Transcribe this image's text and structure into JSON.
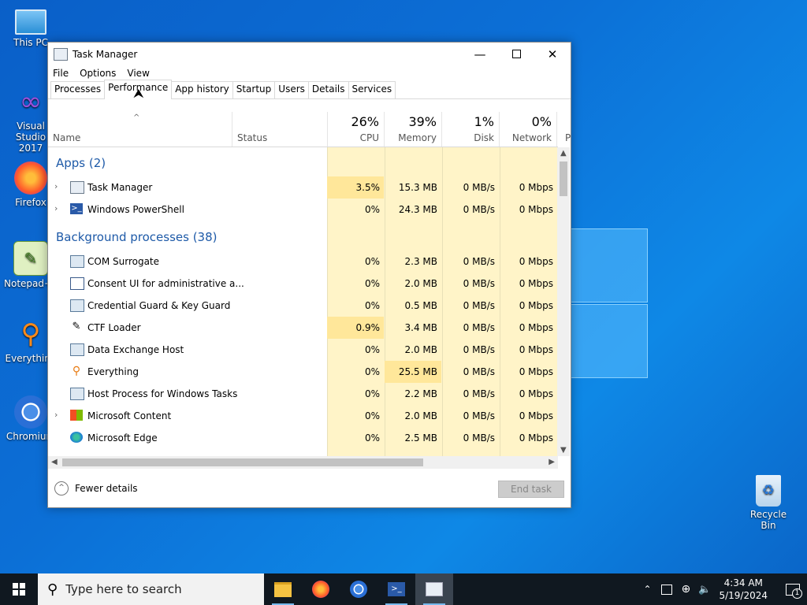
{
  "desktop": {
    "icons": [
      {
        "label": "This PC"
      },
      {
        "label": "Visual Studio 2017"
      },
      {
        "label": "Firefox"
      },
      {
        "label": "Notepad++"
      },
      {
        "label": "Everything"
      },
      {
        "label": "Chromium"
      },
      {
        "label": "Recycle Bin"
      }
    ]
  },
  "window": {
    "title": "Task Manager",
    "menu": [
      "File",
      "Options",
      "View"
    ],
    "tabs": [
      "Processes",
      "Performance",
      "App history",
      "Startup",
      "Users",
      "Details",
      "Services"
    ],
    "active_tab": "Performance",
    "columns": {
      "name": "Name",
      "status": "Status",
      "cpu": {
        "pct": "26%",
        "label": "CPU"
      },
      "memory": {
        "pct": "39%",
        "label": "Memory"
      },
      "disk": {
        "pct": "1%",
        "label": "Disk"
      },
      "network": {
        "pct": "0%",
        "label": "Network"
      },
      "power": "P"
    },
    "groups": {
      "apps": "Apps (2)",
      "background": "Background processes (38)"
    },
    "apps": [
      {
        "name": "Task Manager",
        "cpu": "3.5%",
        "memory": "15.3 MB",
        "disk": "0 MB/s",
        "network": "0 Mbps"
      },
      {
        "name": "Windows PowerShell",
        "cpu": "0%",
        "memory": "24.3 MB",
        "disk": "0 MB/s",
        "network": "0 Mbps"
      }
    ],
    "background": [
      {
        "name": "COM Surrogate",
        "cpu": "0%",
        "memory": "2.3 MB",
        "disk": "0 MB/s",
        "network": "0 Mbps"
      },
      {
        "name": "Consent UI for administrative a...",
        "cpu": "0%",
        "memory": "2.0 MB",
        "disk": "0 MB/s",
        "network": "0 Mbps"
      },
      {
        "name": "Credential Guard & Key Guard",
        "cpu": "0%",
        "memory": "0.5 MB",
        "disk": "0 MB/s",
        "network": "0 Mbps"
      },
      {
        "name": "CTF Loader",
        "cpu": "0.9%",
        "memory": "3.4 MB",
        "disk": "0 MB/s",
        "network": "0 Mbps"
      },
      {
        "name": "Data Exchange Host",
        "cpu": "0%",
        "memory": "2.0 MB",
        "disk": "0 MB/s",
        "network": "0 Mbps"
      },
      {
        "name": "Everything",
        "cpu": "0%",
        "memory": "25.5 MB",
        "disk": "0 MB/s",
        "network": "0 Mbps"
      },
      {
        "name": "Host Process for Windows Tasks",
        "cpu": "0%",
        "memory": "2.2 MB",
        "disk": "0 MB/s",
        "network": "0 Mbps"
      },
      {
        "name": "Microsoft Content",
        "cpu": "0%",
        "memory": "2.0 MB",
        "disk": "0 MB/s",
        "network": "0 Mbps"
      },
      {
        "name": "Microsoft Edge",
        "cpu": "0%",
        "memory": "2.5 MB",
        "disk": "0 MB/s",
        "network": "0 Mbps"
      }
    ],
    "footer": {
      "fewer_details": "Fewer details",
      "end_task": "End task"
    }
  },
  "taskbar": {
    "search_placeholder": "Type here to search",
    "time": "4:34 AM",
    "date": "5/19/2024",
    "notification_count": "1"
  },
  "colors": {
    "accent": "#1e5aa8",
    "heat_low": "#fff4c8",
    "heat_mid": "#ffe79a"
  }
}
